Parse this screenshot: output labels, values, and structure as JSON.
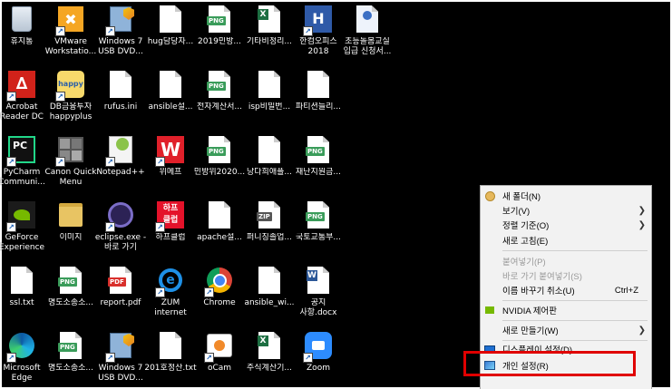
{
  "desktop_icons": [
    {
      "label": "휴지통",
      "icon": "recycle-bin-icon",
      "shortcut": false
    },
    {
      "label": "VMware\nWorkstatio...",
      "icon": "vmware-icon",
      "shortcut": true
    },
    {
      "label": "Windows 7\nUSB DVD...",
      "icon": "windows-usb-icon",
      "shortcut": true
    },
    {
      "label": "hug담당자...",
      "icon": "file-icon",
      "shortcut": false
    },
    {
      "label": "2019민방...",
      "icon": "png-file-icon",
      "badge": "PNG",
      "shortcut": false
    },
    {
      "label": "기타비정리...",
      "icon": "excel-file-icon",
      "shortcut": false
    },
    {
      "label": "한컴오피스\n2018",
      "icon": "hancom-icon",
      "shortcut": true
    },
    {
      "label": "초등돌봄교실\n입급 신청서...",
      "icon": "hwp-file-icon",
      "shortcut": false
    },
    {
      "label": "Acrobat\nReader DC",
      "icon": "acrobat-icon",
      "shortcut": true
    },
    {
      "label": "DB금융투자\nhappyplus",
      "icon": "happyplus-icon",
      "shortcut": true
    },
    {
      "label": "rufus.ini",
      "icon": "ini-file-icon",
      "shortcut": false
    },
    {
      "label": "ansible설...",
      "icon": "file-icon",
      "shortcut": false
    },
    {
      "label": "전자계산서...",
      "icon": "png-file-icon",
      "badge": "PNG",
      "shortcut": false
    },
    {
      "label": "isp비밀번...",
      "icon": "file-icon",
      "shortcut": false
    },
    {
      "label": "파티션늘리...",
      "icon": "file-icon",
      "shortcut": false
    },
    {
      "label": "PyCharm\nCommuni...",
      "icon": "pycharm-icon",
      "shortcut": true
    },
    {
      "label": "Canon Quick\nMenu",
      "icon": "canon-icon",
      "shortcut": true
    },
    {
      "label": "Notepad++",
      "icon": "notepadpp-icon",
      "shortcut": true
    },
    {
      "label": "위메프",
      "icon": "wemakeprice-icon",
      "shortcut": true
    },
    {
      "label": "민방위2020...",
      "icon": "png-file-icon",
      "badge": "PNG",
      "shortcut": false
    },
    {
      "label": "낭다희애플...",
      "icon": "file-icon",
      "shortcut": false
    },
    {
      "label": "재난지원금...",
      "icon": "png-file-icon",
      "badge": "PNG",
      "shortcut": false
    },
    {
      "label": "GeForce\nExperience",
      "icon": "nvidia-icon",
      "shortcut": true
    },
    {
      "label": "이미지",
      "icon": "folder-icon",
      "shortcut": false
    },
    {
      "label": "eclipse.exe -\n바로 가기",
      "icon": "eclipse-icon",
      "shortcut": true
    },
    {
      "label": "하프클럽",
      "icon": "halfclub-icon",
      "shortcut": true
    },
    {
      "label": "apache설...",
      "icon": "file-icon",
      "shortcut": false
    },
    {
      "label": "퍼니칭졸업...",
      "icon": "zip-file-icon",
      "badge": "ZIP",
      "shortcut": false
    },
    {
      "label": "국토교통부...",
      "icon": "png-file-icon",
      "badge": "PNG",
      "shortcut": false
    },
    {
      "label": "ssl.txt",
      "icon": "file-icon",
      "shortcut": false
    },
    {
      "label": "명도소송소...",
      "icon": "png-file-icon",
      "badge": "PNG",
      "shortcut": false
    },
    {
      "label": "report.pdf",
      "icon": "pdf-file-icon",
      "badge": "PDF",
      "shortcut": false
    },
    {
      "label": "ZUM\ninternet",
      "icon": "ie-icon",
      "shortcut": true
    },
    {
      "label": "Chrome",
      "icon": "chrome-icon",
      "shortcut": true
    },
    {
      "label": "ansible_wi...",
      "icon": "file-icon",
      "shortcut": false
    },
    {
      "label": "공지\n사항.docx",
      "icon": "word-file-icon",
      "shortcut": false
    },
    {
      "label": "Microsoft\nEdge",
      "icon": "edge-icon",
      "shortcut": true
    },
    {
      "label": "명도소송소...",
      "icon": "png-file-icon",
      "badge": "PNG",
      "shortcut": false
    },
    {
      "label": "Windows 7\nUSB DVD...",
      "icon": "windows-usb-icon",
      "shortcut": true
    },
    {
      "label": "201호정산.txt",
      "icon": "file-icon",
      "shortcut": false
    },
    {
      "label": "oCam",
      "icon": "ocam-icon",
      "shortcut": true
    },
    {
      "label": "주식계산기...",
      "icon": "excel-file-icon",
      "shortcut": false
    },
    {
      "label": "Zoom",
      "icon": "zoom-icon",
      "shortcut": true
    }
  ],
  "context_menu": {
    "items": [
      {
        "label": "새 폴더(N)",
        "icon": "new-folder-icon",
        "shortcut": "",
        "submenu": false,
        "disabled": false
      },
      {
        "label": "보기(V)",
        "icon": "",
        "shortcut": "",
        "submenu": true,
        "disabled": false
      },
      {
        "label": "정렬 기준(O)",
        "icon": "",
        "shortcut": "",
        "submenu": true,
        "disabled": false
      },
      {
        "label": "새로 고침(E)",
        "icon": "",
        "shortcut": "",
        "submenu": false,
        "disabled": false
      },
      {
        "label": "붙여넣기(P)",
        "icon": "",
        "shortcut": "",
        "submenu": false,
        "disabled": true
      },
      {
        "label": "바로 가기 붙여넣기(S)",
        "icon": "",
        "shortcut": "",
        "submenu": false,
        "disabled": true
      },
      {
        "label": "이름 바꾸기 취소(U)",
        "icon": "",
        "shortcut": "Ctrl+Z",
        "submenu": false,
        "disabled": false
      },
      {
        "label": "NVIDIA 제어판",
        "icon": "nvidia-icon",
        "shortcut": "",
        "submenu": false,
        "disabled": false
      },
      {
        "label": "새로 만들기(W)",
        "icon": "",
        "shortcut": "",
        "submenu": true,
        "disabled": false
      },
      {
        "label": "디스플레이 설정(D)",
        "icon": "display-icon",
        "shortcut": "",
        "submenu": false,
        "disabled": false
      },
      {
        "label": "개인 설정(R)",
        "icon": "personalize-icon",
        "shortcut": "",
        "submenu": false,
        "disabled": false
      }
    ]
  },
  "highlight_color": "#e00000"
}
